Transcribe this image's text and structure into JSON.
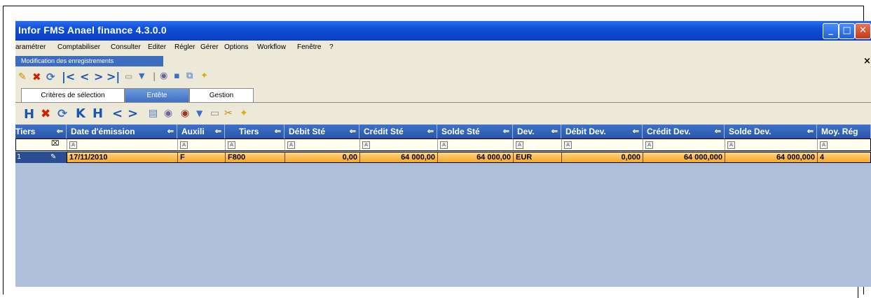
{
  "window": {
    "title": "Infor FMS Anael finance 4.3.0.0",
    "min": "_",
    "max": "□",
    "close": "✕"
  },
  "menu": [
    "aramétrer",
    "Comptabiliser",
    "Consulter",
    "Editer",
    "Régler",
    "Gérer",
    "Options",
    "Workflow",
    "Fenêtre",
    "?"
  ],
  "subwindow": {
    "title": "Modification des enregistrements",
    "close": "×"
  },
  "tabs": [
    "Critères de sélection",
    "Entête",
    "Gestion"
  ],
  "active_tab": "Entête",
  "grid": {
    "columns": [
      "Tiers",
      "Date d'émission",
      "Auxili",
      "Tiers",
      "Débit Sté",
      "Crédit Sté",
      "Solde Sté",
      "Dev.",
      "Débit Dev.",
      "Crédit Dev.",
      "Solde Dev.",
      "Moy. Rég"
    ],
    "filter_glyph": "A",
    "row": {
      "num": "1",
      "marker": "✎",
      "date": "17/11/2010",
      "auxili": "F",
      "tiers": "F800",
      "debit_ste": "0,00",
      "credit_ste": "64 000,00",
      "solde_ste": "64 000,00",
      "dev": "EUR",
      "debit_dev": "0,000",
      "credit_dev": "64 000,000",
      "solde_dev": "64 000,000",
      "moy_reg": "4"
    }
  },
  "colors": {
    "title_blue": "#0e4ed6",
    "grid_header": "#2955a8",
    "row_orange": "#f7a825",
    "grid_bg": "#adbfd9"
  }
}
